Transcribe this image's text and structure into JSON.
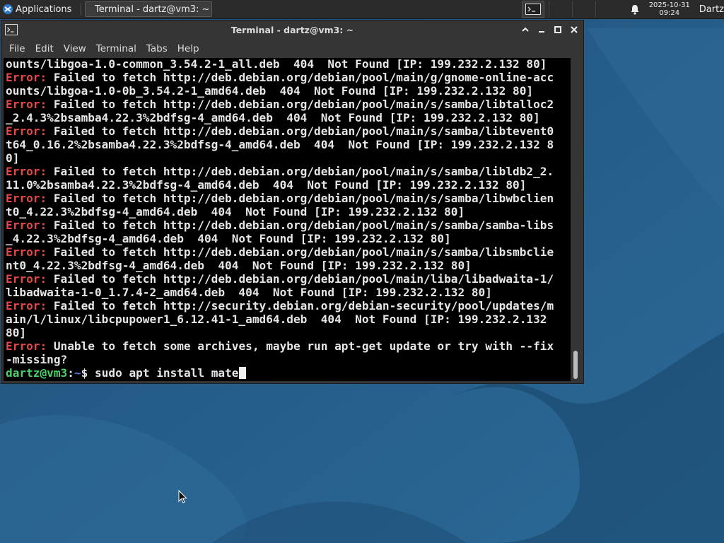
{
  "panel": {
    "applications_label": "Applications",
    "task_title": "Terminal - dartz@vm3: ~",
    "clock_date": "2025-10-31",
    "clock_time": "09:24",
    "user_name": "Dartz"
  },
  "window": {
    "title": "Terminal - dartz@vm3: ~",
    "menu": [
      "File",
      "Edit",
      "View",
      "Terminal",
      "Tabs",
      "Help"
    ]
  },
  "terminal": {
    "lines": [
      {
        "err": "",
        "text": "ounts/libgoa-1.0-common_3.54.2-1_all.deb  404  Not Found [IP: 199.232.2.132 80]"
      },
      {
        "err": "Error:",
        "text": " Failed to fetch http://deb.debian.org/debian/pool/main/g/gnome-online-acc"
      },
      {
        "err": "",
        "text": "ounts/libgoa-1.0-0b_3.54.2-1_amd64.deb  404  Not Found [IP: 199.232.2.132 80]"
      },
      {
        "err": "Error:",
        "text": " Failed to fetch http://deb.debian.org/debian/pool/main/s/samba/libtalloc2"
      },
      {
        "err": "",
        "text": "_2.4.3%2bsamba4.22.3%2bdfsg-4_amd64.deb  404  Not Found [IP: 199.232.2.132 80]"
      },
      {
        "err": "Error:",
        "text": " Failed to fetch http://deb.debian.org/debian/pool/main/s/samba/libtevent0"
      },
      {
        "err": "",
        "text": "t64_0.16.2%2bsamba4.22.3%2bdfsg-4_amd64.deb  404  Not Found [IP: 199.232.2.132 8"
      },
      {
        "err": "",
        "text": "0]"
      },
      {
        "err": "Error:",
        "text": " Failed to fetch http://deb.debian.org/debian/pool/main/s/samba/libldb2_2."
      },
      {
        "err": "",
        "text": "11.0%2bsamba4.22.3%2bdfsg-4_amd64.deb  404  Not Found [IP: 199.232.2.132 80]"
      },
      {
        "err": "Error:",
        "text": " Failed to fetch http://deb.debian.org/debian/pool/main/s/samba/libwbclien"
      },
      {
        "err": "",
        "text": "t0_4.22.3%2bdfsg-4_amd64.deb  404  Not Found [IP: 199.232.2.132 80]"
      },
      {
        "err": "Error:",
        "text": " Failed to fetch http://deb.debian.org/debian/pool/main/s/samba/samba-libs"
      },
      {
        "err": "",
        "text": "_4.22.3%2bdfsg-4_amd64.deb  404  Not Found [IP: 199.232.2.132 80]"
      },
      {
        "err": "Error:",
        "text": " Failed to fetch http://deb.debian.org/debian/pool/main/s/samba/libsmbclie"
      },
      {
        "err": "",
        "text": "nt0_4.22.3%2bdfsg-4_amd64.deb  404  Not Found [IP: 199.232.2.132 80]"
      },
      {
        "err": "Error:",
        "text": " Failed to fetch http://deb.debian.org/debian/pool/main/liba/libadwaita-1/"
      },
      {
        "err": "",
        "text": "libadwaita-1-0_1.7.4-2_amd64.deb  404  Not Found [IP: 199.232.2.132 80]"
      },
      {
        "err": "Error:",
        "text": " Failed to fetch http://security.debian.org/debian-security/pool/updates/m"
      },
      {
        "err": "",
        "text": "ain/l/linux/libcpupower1_6.12.41-1_amd64.deb  404  Not Found [IP: 199.232.2.132"
      },
      {
        "err": "",
        "text": "80]"
      },
      {
        "err": "Error:",
        "text": " Unable to fetch some archives, maybe run apt-get update or try with --fix"
      },
      {
        "err": "",
        "text": "-missing?"
      }
    ],
    "prompt_user": "dartz@vm3",
    "prompt_colon": ":",
    "prompt_path": "~",
    "prompt_symbol": "$ ",
    "command": "sudo apt install mate"
  },
  "colors": {
    "error": "#e34848",
    "prompt_user": "#49d36a",
    "prompt_path": "#5a7fe6"
  }
}
